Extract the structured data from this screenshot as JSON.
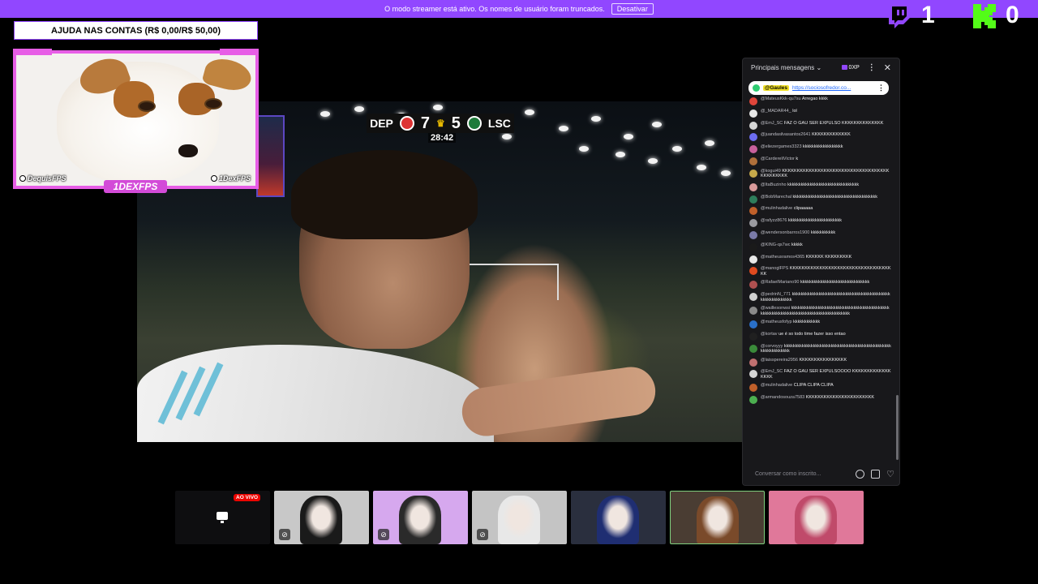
{
  "banner": {
    "text": "O modo streamer está ativo. Os nomes de usuário foram truncados.",
    "button": "Desativar",
    "color": "#9147ff"
  },
  "counters": {
    "twitch": "1",
    "kick": "0",
    "twitch_color": "#9147ff",
    "kick_color": "#53fc18"
  },
  "goal": {
    "label": "AJUDA NAS CONTAS (R$ 0,00/R$ 50,00)"
  },
  "dogcam": {
    "left_tag": "DequisFPS",
    "right_tag": "1DexFPS",
    "name_tag": "1DEXFPS",
    "frame_color": "#e75ee6"
  },
  "scoreboard": {
    "home": "DEP",
    "home_score": "7",
    "away_score": "5",
    "away": "LSC",
    "clock": "28:42"
  },
  "chat": {
    "title": "Principais mensagens",
    "xp": "0XP",
    "pinned": {
      "user": "@Gaules",
      "link": "https://sociosofredor.co..."
    },
    "placeholder": "Conversar como inscrito...",
    "messages": [
      {
        "nick": "@MateusKkk-qu7su",
        "text": "Arregao kkkk",
        "color": "#e0453a"
      },
      {
        "nick": "@_MADAR44_",
        "text": "lol",
        "color": "#e8e8e8"
      },
      {
        "nick": "@EmJ_SC",
        "text": "FAZ O GAU SER EXPULSO KKKKKKKKKKKKKK",
        "color": "#d5d5d5"
      },
      {
        "nick": "@juandasilvasantos2641",
        "text": "KKKKKKKKKKKKK",
        "color": "#6c6cf0"
      },
      {
        "nick": "@eliezergames3323",
        "text": "kkkkkkkkkkkkkkkkkk",
        "color": "#c7609b"
      },
      {
        "nick": "@CardereliVictor",
        "text": "k",
        "color": "#b0703a"
      },
      {
        "nick": "@kogui49",
        "text": "KKKKKKKKKKKKKKKKKKKKKKKKKKKKKKKKKKKKKKKKKKKKK",
        "color": "#c7a94a"
      },
      {
        "nick": "@ItaBuzinho",
        "text": "kkkkkkkkkkkkkkkkkkkkkkkkkkkkkkkk",
        "color": "#d99a9a"
      },
      {
        "nick": "@BobMarechal",
        "text": "kkkkkkkkkkkkkkkkkkkkkkkkkkkkkkkkkkkkkk",
        "color": "#2e7d5b"
      },
      {
        "nick": "@mulinhadalive",
        "text": "clipaaaaa",
        "color": "#c0602a"
      },
      {
        "nick": "@rafyzz8676",
        "text": "kkkkkkkkkkkkkkkkkkkkkkkk",
        "color": "#9a9aa0"
      },
      {
        "nick": "@wendersonbarros1900",
        "text": "kkkkkkkkkkk",
        "color": "#7a7aa8"
      },
      {
        "nick": "@KING-qs7wc",
        "text": "kkkkk",
        "color": "#1a1a1a"
      },
      {
        "nick": "@matheusramos4365",
        "text": "KKKKKK KKKKKKKKK",
        "color": "#e8e8e8"
      },
      {
        "nick": "@manoglFPS",
        "text": "KKKKKKKKKKKKKKKKKKKKKKKKKKKKKKKKKKKK",
        "color": "#e04a1f"
      },
      {
        "nick": "@RafaelMariano90",
        "text": "kkkkkkkkkkkkkkkkkkkkkkkkkkkkkkk",
        "color": "#b05050"
      },
      {
        "nick": "@pedrinN_771",
        "text": "kkkkkkkkkkkkkkkkkkkkkkkkkkkkkkkkkkkkkkkkkkkkkkkkkkkkkkkkkk",
        "color": "#d0d0d0"
      },
      {
        "nick": "@waillesonwsi",
        "text": "kkkkkkkkkkkkkkkkkkkkkkkkkkkkkkkkkkkkkkkkkkkkkkkkkkkkkkkkkkkkkkkkkkkkkkkkkkkkkkkkkkkk",
        "color": "#8a8a8a"
      },
      {
        "nick": "@matheusfofyp",
        "text": "kkkkkkkkkkkk",
        "color": "#2a70c8"
      },
      {
        "nick": "@kortav",
        "text": "ue é so todo time fazer isso entao",
        "color": "#202020"
      },
      {
        "nick": "@corvoyyy",
        "text": "kkkkkkkkkkkkkkkkkkkkkkkkkkkkkkkkkkkkkkkkkkkkkkkkkkkkkkkkkkkkk",
        "color": "#3a8a3a"
      },
      {
        "nick": "@laisspereira2956",
        "text": "KKKKKKKKKKKKKKKK",
        "color": "#c07070"
      },
      {
        "nick": "@EmJ_SC",
        "text": "FAZ O GAU SER EXPULSOOOO KKKKKKKKKKKKKKKKK",
        "color": "#d5d5d5"
      },
      {
        "nick": "@mulinhadalive",
        "text": "CLIPA CLIPA CLIPA",
        "color": "#c0602a"
      },
      {
        "nick": "@armandosouza7583",
        "text": "KKKKKKKKKKKKKKKKKKKKKKK",
        "color": "#4caf50"
      }
    ]
  },
  "tiles": {
    "live_label": "AO VIVO",
    "items": [
      {
        "kind": "screen",
        "bg": "#0e0e10"
      },
      {
        "kind": "avatar",
        "bg": "#c8c8c8",
        "accent": "#1a1a1a",
        "muted": true
      },
      {
        "kind": "avatar",
        "bg": "#d6a8ee",
        "accent": "#2a2a2a",
        "muted": true
      },
      {
        "kind": "avatar",
        "bg": "#c4c4c4",
        "accent": "#e8e8e8",
        "muted": true
      },
      {
        "kind": "avatar",
        "bg": "#2a2f3e",
        "accent": "#1f2e72",
        "muted": false
      },
      {
        "kind": "avatar",
        "bg": "#4a3d33",
        "accent": "#7a4a2a",
        "muted": false
      },
      {
        "kind": "avatar",
        "bg": "#e0789a",
        "accent": "#c04a6a",
        "muted": false
      }
    ]
  }
}
